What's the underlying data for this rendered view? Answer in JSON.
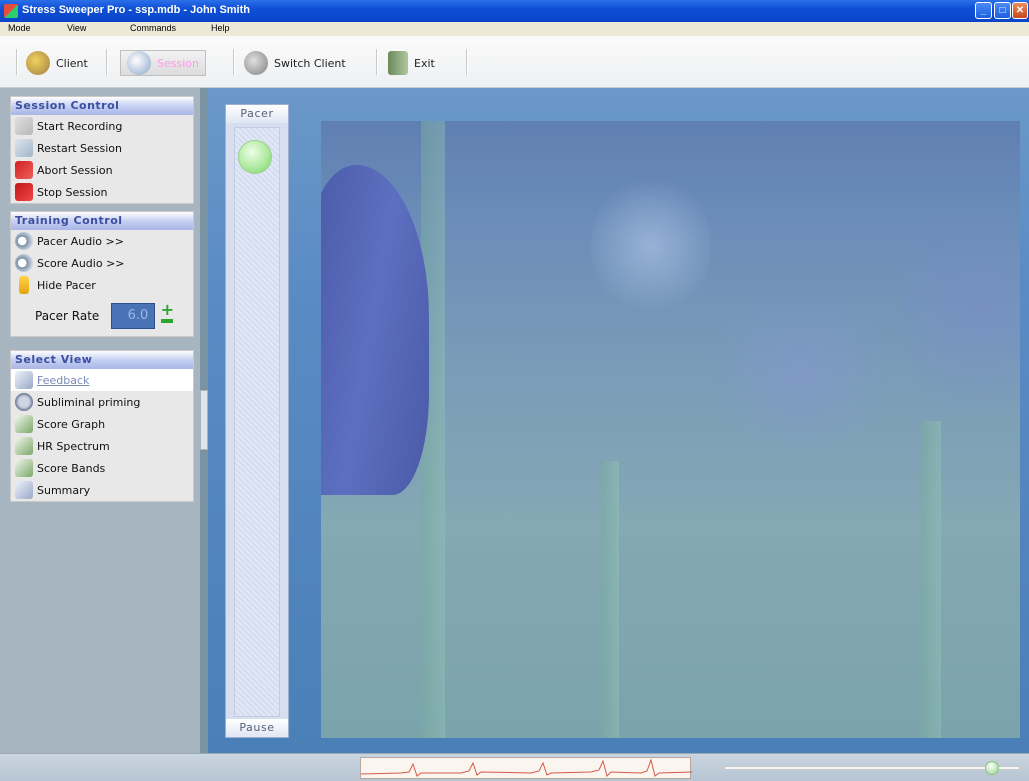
{
  "window": {
    "title": "Stress Sweeper Pro - ssp.mdb - John Smith"
  },
  "menu": [
    "Mode",
    "View",
    "Commands",
    "Help"
  ],
  "toolbar": {
    "client_label": "Client",
    "session_label": "Session",
    "switch_client_label": "Switch Client",
    "exit_label": "Exit"
  },
  "session_control": {
    "title": "Session Control",
    "items": [
      {
        "label": "Start Recording",
        "icon": "record-icon"
      },
      {
        "label": "Restart Session",
        "icon": "restart-icon"
      },
      {
        "label": "Abort Session",
        "icon": "abort-icon"
      },
      {
        "label": "Stop Session",
        "icon": "stop-icon"
      }
    ]
  },
  "training_control": {
    "title": "Training Control",
    "items": [
      {
        "label": "Pacer Audio >>",
        "icon": "audio-icon"
      },
      {
        "label": "Score Audio >>",
        "icon": "audio-icon"
      },
      {
        "label": "Hide Pacer",
        "icon": "pacer-icon"
      }
    ],
    "pacer_rate_label": "Pacer Rate",
    "pacer_rate_value": "6.0"
  },
  "select_view": {
    "title": "Select View",
    "items": [
      {
        "label": "Feedback",
        "selected": true
      },
      {
        "label": "Subliminal priming",
        "selected": false
      },
      {
        "label": "Score Graph",
        "selected": false
      },
      {
        "label": "HR Spectrum",
        "selected": false
      },
      {
        "label": "Score Bands",
        "selected": false
      },
      {
        "label": "Summary",
        "selected": false
      }
    ]
  },
  "pacer": {
    "title": "Pacer",
    "pause_label": "Pause"
  },
  "colors": {
    "titlebar": "#0f4fd6",
    "section_header_text": "#3d4fa0",
    "active_session_text": "#ff99ee",
    "pacer_rate_bg": "#4a73b6",
    "pacer_ball": "#a9e89a",
    "ecg_line": "#d55a4a"
  },
  "status": {
    "volume_level": 0.9
  }
}
